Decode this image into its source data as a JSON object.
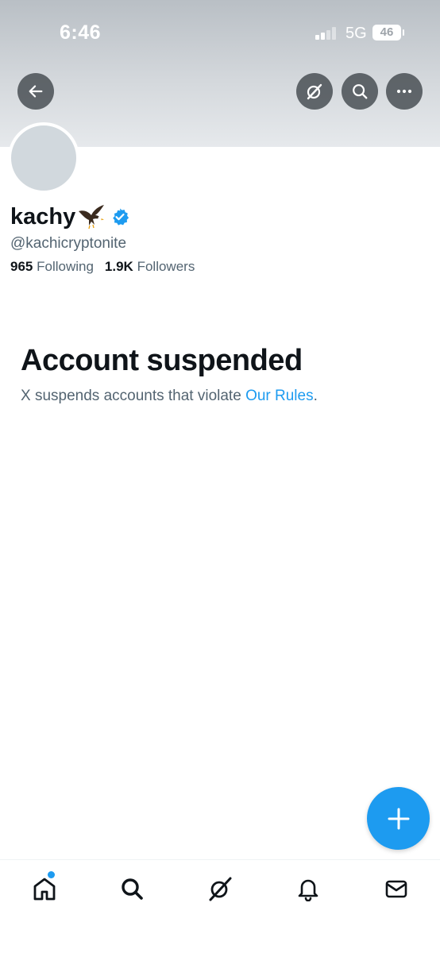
{
  "status_bar": {
    "time": "6:46",
    "network": "5G",
    "battery": "46"
  },
  "profile": {
    "display_name": "kachy",
    "handle": "@kachicryptonite",
    "following_count": "965",
    "following_label": "Following",
    "followers_count": "1.9K",
    "followers_label": "Followers"
  },
  "suspension": {
    "title": "Account suspended",
    "message": "X suspends accounts that violate ",
    "link_text": "Our Rules",
    "trailing": "."
  },
  "header_buttons": [
    "back-arrow-icon",
    "grok-icon",
    "search-icon",
    "more-icon"
  ],
  "tabs": [
    "home-icon",
    "search-icon",
    "grok-icon",
    "notifications-bell-icon",
    "messages-envelope-icon"
  ],
  "colors": {
    "accent": "#1d9bf0",
    "text_primary": "#0f1419",
    "text_secondary": "#536471",
    "banner": "#c9ced3"
  }
}
